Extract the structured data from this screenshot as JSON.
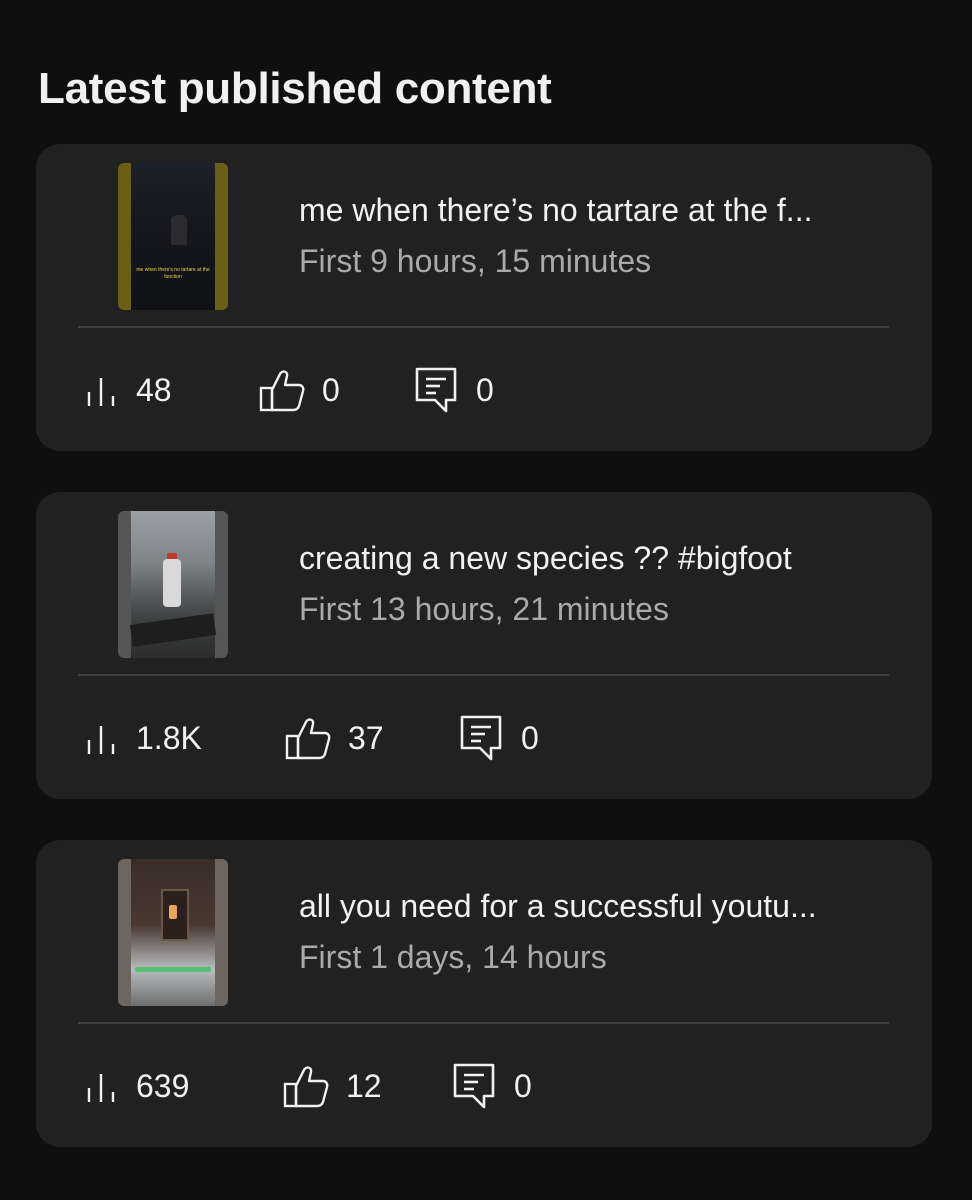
{
  "section": {
    "title": "Latest published content"
  },
  "items": [
    {
      "title": "me when there’s no tartare at the f...",
      "subtitle": "First 9 hours, 15 minutes",
      "thumb_caption": "me when there's no tartare at the function",
      "views": "48",
      "likes": "0",
      "comments": "0"
    },
    {
      "title": "creating a new species ?? #bigfoot",
      "subtitle": "First 13 hours, 21 minutes",
      "views": "1.8K",
      "likes": "37",
      "comments": "0"
    },
    {
      "title": "all you need for a successful youtu...",
      "subtitle": "First 1 days, 14 hours",
      "views": "639",
      "likes": "12",
      "comments": "0"
    }
  ],
  "icons": {
    "views": "bar-chart-icon",
    "likes": "thumbs-up-icon",
    "comments": "comment-icon"
  },
  "colors": {
    "background": "#0f0f0f",
    "card": "#212121",
    "text_primary": "#f1f1f1",
    "text_secondary": "#aaaaaa"
  }
}
